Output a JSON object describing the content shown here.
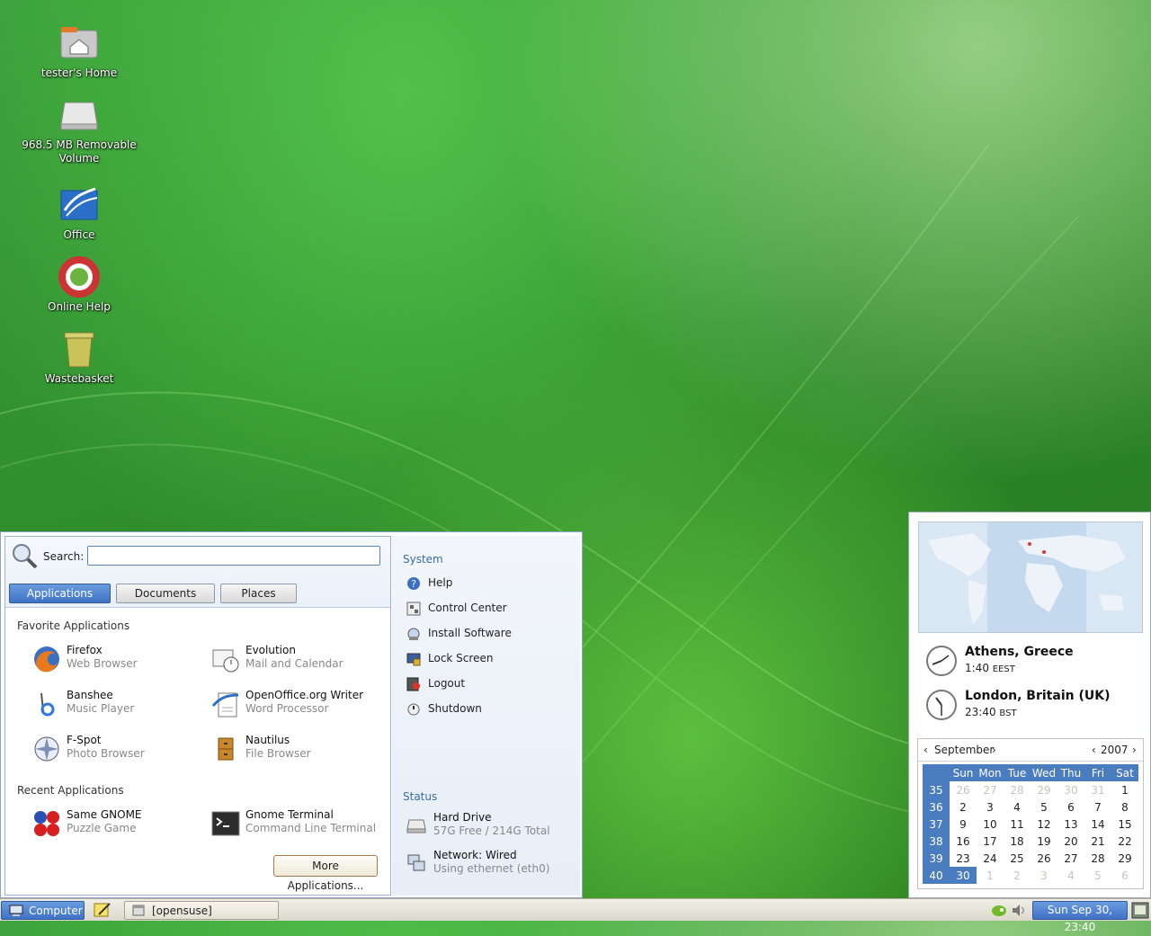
{
  "desktop": {
    "icons": [
      {
        "label": "tester's Home"
      },
      {
        "label": "968.5 MB Removable Volume"
      },
      {
        "label": "Office"
      },
      {
        "label": "Online Help"
      },
      {
        "label": "Wastebasket"
      }
    ]
  },
  "menu": {
    "search_label": "Search:",
    "search_value": "",
    "tabs": [
      {
        "label": "Applications"
      },
      {
        "label": "Documents"
      },
      {
        "label": "Places"
      }
    ],
    "favorites_title": "Favorite Applications",
    "favorites": [
      {
        "name": "Firefox",
        "desc": "Web Browser",
        "icon": "firefox-icon"
      },
      {
        "name": "Evolution",
        "desc": "Mail and Calendar",
        "icon": "evolution-icon"
      },
      {
        "name": "Banshee",
        "desc": "Music Player",
        "icon": "banshee-icon"
      },
      {
        "name": "OpenOffice.org Writer",
        "desc": "Word Processor",
        "icon": "writer-icon"
      },
      {
        "name": "F-Spot",
        "desc": "Photo Browser",
        "icon": "fspot-icon"
      },
      {
        "name": "Nautilus",
        "desc": "File Browser",
        "icon": "nautilus-icon"
      }
    ],
    "recent_title": "Recent Applications",
    "recent": [
      {
        "name": "Same GNOME",
        "desc": "Puzzle Game",
        "icon": "same-gnome-icon"
      },
      {
        "name": "Gnome Terminal",
        "desc": "Command Line Terminal",
        "icon": "terminal-icon"
      }
    ],
    "more_apps_label": "More Applications...",
    "system_title": "System",
    "system_items": [
      {
        "label": "Help"
      },
      {
        "label": "Control Center"
      },
      {
        "label": "Install Software"
      },
      {
        "label": "Lock Screen"
      },
      {
        "label": "Logout"
      },
      {
        "label": "Shutdown"
      }
    ],
    "status_title": "Status",
    "status_items": [
      {
        "name": "Hard Drive",
        "desc": "57G Free / 214G Total"
      },
      {
        "name": "Network: Wired",
        "desc": "Using ethernet (eth0)"
      }
    ]
  },
  "clock_panel": {
    "cities": [
      {
        "name": "Athens, Greece",
        "time": "1:40",
        "zone": "EEST"
      },
      {
        "name": "London, Britain (UK)",
        "time": "23:40",
        "zone": "BST"
      }
    ],
    "calendar": {
      "month": "September",
      "year": "2007",
      "weekdays": [
        "Sun",
        "Mon",
        "Tue",
        "Wed",
        "Thu",
        "Fri",
        "Sat"
      ],
      "weeks": [
        {
          "week": "35",
          "days": [
            "26",
            "27",
            "28",
            "29",
            "30",
            "31",
            "1"
          ]
        },
        {
          "week": "36",
          "days": [
            "2",
            "3",
            "4",
            "5",
            "6",
            "7",
            "8"
          ]
        },
        {
          "week": "37",
          "days": [
            "9",
            "10",
            "11",
            "12",
            "13",
            "14",
            "15"
          ]
        },
        {
          "week": "38",
          "days": [
            "16",
            "17",
            "18",
            "19",
            "20",
            "21",
            "22"
          ]
        },
        {
          "week": "39",
          "days": [
            "23",
            "24",
            "25",
            "26",
            "27",
            "28",
            "29"
          ]
        },
        {
          "week": "40",
          "days": [
            "30",
            "1",
            "2",
            "3",
            "4",
            "5",
            "6"
          ]
        }
      ],
      "selected_day": "30"
    }
  },
  "taskbar": {
    "computer_label": "Computer",
    "window_label": "[opensuse]",
    "clock": "Sun Sep 30, 23:40"
  }
}
